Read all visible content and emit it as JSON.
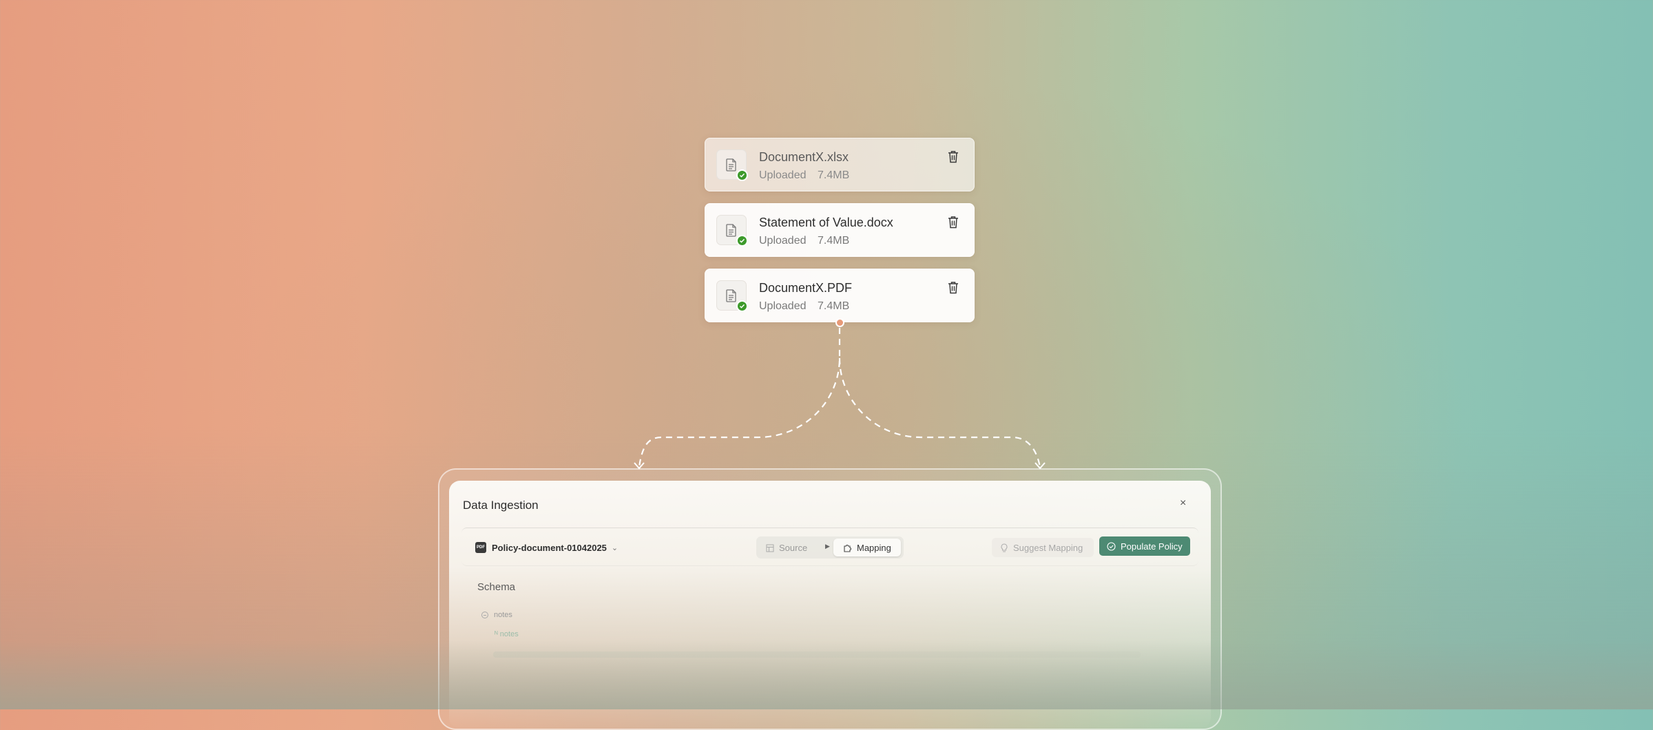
{
  "files": [
    {
      "name": "DocumentX.xlsx",
      "status": "Uploaded",
      "size": "7.4MB"
    },
    {
      "name": "Statement of Value.docx",
      "status": "Uploaded",
      "size": "7.4MB"
    },
    {
      "name": "DocumentX.PDF",
      "status": "Uploaded",
      "size": "7.4MB"
    }
  ],
  "panel": {
    "title": "Data Ingestion",
    "close_label": "×",
    "document": {
      "badge": "PDF",
      "name": "Policy-document-01042025"
    },
    "steps": {
      "source_label": "Source",
      "mapping_label": "Mapping",
      "active": "Mapping"
    },
    "suggest_label": "Suggest Mapping",
    "populate_label": "Populate Policy",
    "schema": {
      "heading": "Schema",
      "nodes": [
        {
          "label": "notes"
        },
        {
          "label": "ᴺ notes"
        }
      ]
    }
  },
  "colors": {
    "accent": "#4d8a73",
    "check": "#3d9a2b",
    "connector_dot": "#e89a78"
  }
}
